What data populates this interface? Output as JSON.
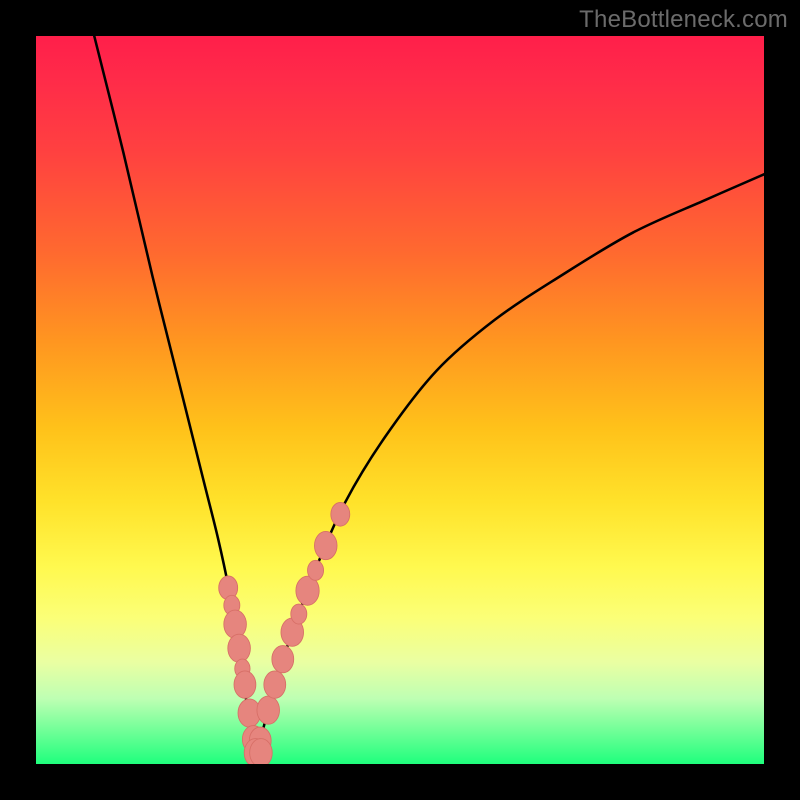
{
  "watermark": "TheBottleneck.com",
  "colors": {
    "curve": "#000000",
    "bead_fill": "#e6857e",
    "bead_stroke": "#d76f67",
    "background_black": "#000000"
  },
  "chart_data": {
    "type": "line",
    "title": "",
    "xlabel": "",
    "ylabel": "",
    "xlim": [
      0,
      100
    ],
    "ylim": [
      0,
      100
    ],
    "series": [
      {
        "name": "left-branch",
        "x": [
          8,
          12,
          16,
          20,
          23,
          25,
          26.5,
          27.5,
          28.3,
          29,
          29.6,
          30.2
        ],
        "y": [
          100,
          84,
          67,
          51,
          39,
          31,
          24,
          18,
          12.5,
          8,
          4,
          1.6
        ]
      },
      {
        "name": "right-branch",
        "x": [
          30.2,
          31,
          32,
          33.5,
          35.5,
          38.5,
          42.5,
          48,
          55,
          63,
          72,
          82,
          92,
          100
        ],
        "y": [
          1.6,
          4,
          8,
          13,
          19,
          27,
          36,
          45,
          54,
          61,
          67,
          73,
          77.5,
          81
        ]
      }
    ],
    "beads_left": [
      {
        "x": 26.4,
        "y": 24.2,
        "r": 1.3
      },
      {
        "x": 26.9,
        "y": 21.8,
        "r": 1.1
      },
      {
        "x": 27.35,
        "y": 19.2,
        "r": 1.55
      },
      {
        "x": 27.9,
        "y": 15.9,
        "r": 1.55
      },
      {
        "x": 28.35,
        "y": 13.1,
        "r": 1.05
      },
      {
        "x": 28.7,
        "y": 10.9,
        "r": 1.5
      },
      {
        "x": 29.3,
        "y": 7.0,
        "r": 1.55
      },
      {
        "x": 29.85,
        "y": 3.4,
        "r": 1.5
      }
    ],
    "beads_right": [
      {
        "x": 30.8,
        "y": 3.2,
        "r": 1.5
      },
      {
        "x": 31.9,
        "y": 7.4,
        "r": 1.55
      },
      {
        "x": 32.8,
        "y": 10.9,
        "r": 1.5
      },
      {
        "x": 33.9,
        "y": 14.4,
        "r": 1.5
      },
      {
        "x": 35.2,
        "y": 18.1,
        "r": 1.55
      },
      {
        "x": 36.1,
        "y": 20.6,
        "r": 1.1
      },
      {
        "x": 37.3,
        "y": 23.8,
        "r": 1.6
      },
      {
        "x": 38.4,
        "y": 26.6,
        "r": 1.1
      },
      {
        "x": 39.8,
        "y": 30.0,
        "r": 1.55
      },
      {
        "x": 41.8,
        "y": 34.3,
        "r": 1.3
      }
    ],
    "beads_bottom": [
      {
        "x": 30.15,
        "y": 1.55,
        "r": 1.55
      },
      {
        "x": 30.9,
        "y": 1.55,
        "r": 1.55
      }
    ]
  }
}
